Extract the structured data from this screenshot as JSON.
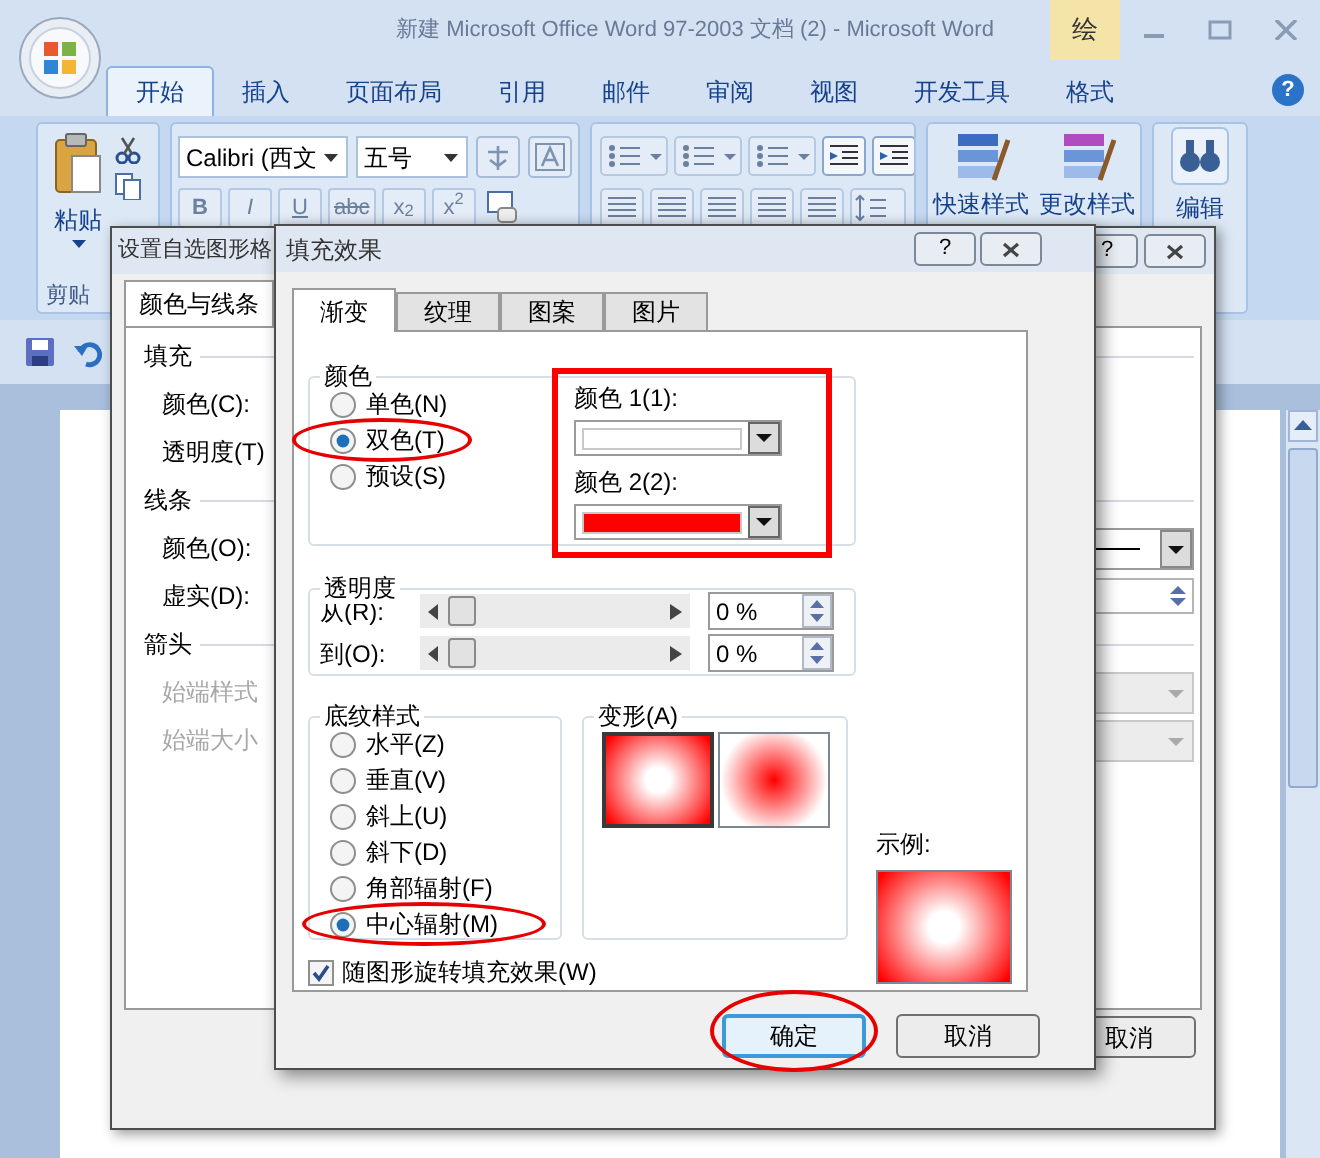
{
  "window": {
    "title": "新建 Microsoft Office Word 97-2003 文档 (2) - Microsoft Word",
    "context_label": "绘",
    "help_glyph": "?"
  },
  "ribbon_tabs": [
    {
      "label": "开始",
      "selected": true
    },
    {
      "label": "插入",
      "selected": false
    },
    {
      "label": "页面布局",
      "selected": false
    },
    {
      "label": "引用",
      "selected": false
    },
    {
      "label": "邮件",
      "selected": false
    },
    {
      "label": "审阅",
      "selected": false
    },
    {
      "label": "视图",
      "selected": false
    },
    {
      "label": "开发工具",
      "selected": false
    },
    {
      "label": "格式",
      "selected": false
    }
  ],
  "ribbon": {
    "clipboard": {
      "paste": "粘贴",
      "group_label": "剪贴"
    },
    "font": {
      "name": "Calibri (西文",
      "size": "五号",
      "buttons": [
        "B",
        "I",
        "U",
        "abc",
        "x$_{2}$",
        "x$^{2}$"
      ]
    },
    "styles": [
      "快速样式",
      "更改样式"
    ],
    "editing": "编辑"
  },
  "format_dialog": {
    "title": "设置自选图形格",
    "help_glyph": "?",
    "tab": "颜色与线条",
    "rows": [
      {
        "kind": "heading",
        "label": "填充"
      },
      {
        "kind": "label",
        "label": "颜色(C):",
        "disabled": false
      },
      {
        "kind": "label",
        "label": "透明度(T)",
        "disabled": false
      },
      {
        "kind": "heading",
        "label": "线条"
      },
      {
        "kind": "linecombo",
        "label": "颜色(O):",
        "disabled": false
      },
      {
        "kind": "spinner",
        "label": "虚实(D):",
        "disabled": false
      },
      {
        "kind": "heading",
        "label": "箭头"
      },
      {
        "kind": "dropdown",
        "label": "始端样式",
        "disabled": true
      },
      {
        "kind": "dropdown",
        "label": "始端大小",
        "disabled": true
      }
    ],
    "cancel": "取消"
  },
  "fill_dialog": {
    "title": "填充效果",
    "help_glyph": "?",
    "tabs": [
      {
        "label": "渐变",
        "selected": true
      },
      {
        "label": "纹理",
        "selected": false
      },
      {
        "label": "图案",
        "selected": false
      },
      {
        "label": "图片",
        "selected": false
      }
    ],
    "colors_group": {
      "title": "颜色",
      "boxed": true,
      "options": [
        {
          "label": "单色(N)",
          "selected": false,
          "circled": false
        },
        {
          "label": "双色(T)",
          "selected": true,
          "circled": true
        },
        {
          "label": "预设(S)",
          "selected": false,
          "circled": false
        }
      ],
      "color_1": {
        "label": "颜色 1(1):",
        "color": "#ffffff"
      },
      "color_2": {
        "label": "颜色 2(2):",
        "color": "#ff0000"
      }
    },
    "transparency_group": {
      "title": "透明度",
      "rows": [
        {
          "label": "从(R):",
          "level": 0,
          "value": "0 %"
        },
        {
          "label": "到(O):",
          "level": 0,
          "value": "0 %"
        }
      ]
    },
    "shading_group": {
      "title": "底纹样式",
      "options": [
        {
          "label": "水平(Z)",
          "selected": false,
          "circled": false
        },
        {
          "label": "垂直(V)",
          "selected": false,
          "circled": false
        },
        {
          "label": "斜上(U)",
          "selected": false,
          "circled": false
        },
        {
          "label": "斜下(D)",
          "selected": false,
          "circled": false
        },
        {
          "label": "角部辐射(F)",
          "selected": false,
          "circled": false
        },
        {
          "label": "中心辐射(M)",
          "selected": true,
          "circled": true
        }
      ]
    },
    "variants_group": {
      "title": "变形(A)",
      "variants": [
        {
          "kind": "edges",
          "selected": true
        },
        {
          "kind": "center",
          "selected": false
        }
      ]
    },
    "sample_label": "示例:",
    "rotate_with_shape": {
      "label": "随图形旋转填充效果(W)",
      "checked": true
    },
    "buttons": [
      {
        "label": "确定",
        "default": true,
        "circled": true
      },
      {
        "label": "取消",
        "default": false,
        "circled": false
      }
    ]
  }
}
